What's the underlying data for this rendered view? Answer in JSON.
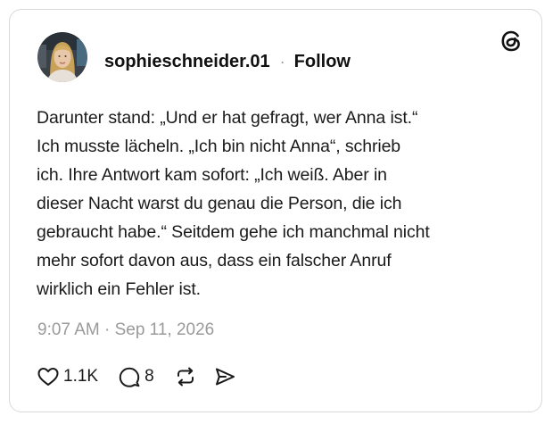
{
  "post": {
    "author": "sophieschneider.01",
    "separator": "·",
    "follow_label": "Follow",
    "text_lines": [
      "Darunter stand: „Und er hat gefragt, wer Anna ist.“",
      "Ich musste lächeln. „Ich bin nicht Anna“, schrieb",
      "ich. Ihre Antwort kam sofort: „Ich weiß. Aber in",
      "dieser Nacht warst du genau die Person, die ich",
      "gebraucht habe.“ Seitdem gehe ich manchmal nicht",
      "mehr sofort davon aus, dass ein falscher Anruf",
      "wirklich ein Fehler ist."
    ],
    "timestamp": "9:07 AM · Sep 11, 2026",
    "likes": "1.1K",
    "replies": "8"
  },
  "icons": {
    "logo": "threads-icon",
    "like": "heart-icon",
    "reply": "comment-icon",
    "repost": "repost-icon",
    "share": "send-icon"
  },
  "colors": {
    "text": "#1a1a1a",
    "muted": "#9a9a9a",
    "border": "#d9d9d9"
  }
}
